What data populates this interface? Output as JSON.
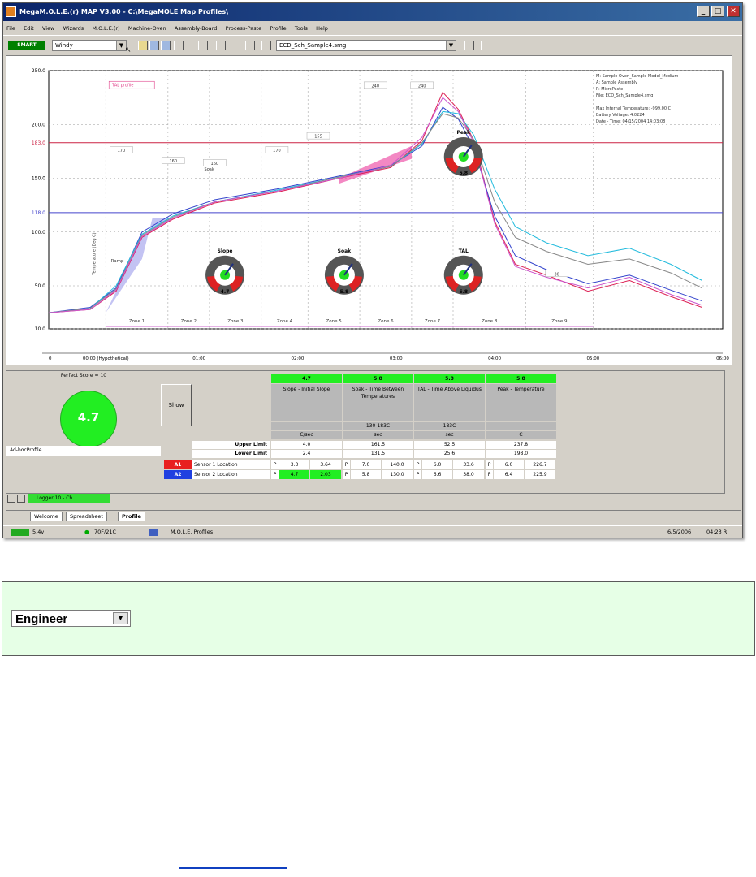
{
  "window": {
    "title": "MegaM.O.L.E.(r) MAP V3.00 - C:\\MegaMOLE Map Profiles\\",
    "controls": [
      "_",
      "□",
      "✕"
    ]
  },
  "menu": [
    "File",
    "Edit",
    "View",
    "Wizards",
    "M.O.L.E.(r)",
    "Machine-Oven",
    "Assembly-Board",
    "Process-Paste",
    "Profile",
    "Tools",
    "Help"
  ],
  "toolbar": {
    "logo": "SMART",
    "view_combo": "Windy",
    "profile_combo": "ECD_Sch_Sample4.smg",
    "pointer_glyph": "↖"
  },
  "chart_data": {
    "type": "line",
    "title": "",
    "ylabel": "",
    "xlabel": "",
    "ylim": [
      10,
      250
    ],
    "yticks": [
      "250.0",
      "200.0",
      "183.0",
      "150.0",
      "118.0",
      "100.0",
      "50.0",
      "10.0"
    ],
    "xticks": [
      "0",
      "00:00 (Hypothetical)",
      "01:00",
      "02:00",
      "03:00",
      "04:00",
      "05:00",
      "06:00"
    ],
    "xlim": [
      0,
      6.5
    ],
    "ref_lines": [
      {
        "label": "183.0",
        "y": 183,
        "color": "#cc2244"
      },
      {
        "label": "118.0",
        "y": 118,
        "color": "#4444cc"
      }
    ],
    "zones": [
      "Zone 1",
      "Zone 2",
      "Zone 3",
      "Zone 4",
      "Zone 5",
      "Zone 6",
      "Zone 7",
      "Zone 8",
      "Zone 9"
    ],
    "zone_boundaries": [
      0.55,
      1.15,
      1.55,
      2.05,
      2.5,
      3.0,
      3.5,
      3.9,
      4.6,
      5.25
    ],
    "annotations": {
      "liquidus_label": "TAL profile",
      "ramp": "Ramp",
      "soak_marker": "Soak",
      "boxes": [
        "170",
        "160",
        "160",
        "170",
        "240",
        "240",
        "155",
        "30"
      ],
      "side_label": "Temperature (Deg C)"
    },
    "info_text": [
      "M: Sample Oven_Sample Model_Medium",
      "A: Sample Assembly",
      "P: MicroPaste",
      "File: ECD_Sch_Sample4.smg",
      "",
      "Max Internal Temperature: -999.00 C",
      "Battery Voltage: 4.0224",
      "Date - Time: 04/15/2004 14:03:08"
    ],
    "gauges": [
      {
        "label": "Slope",
        "value": "4.7"
      },
      {
        "label": "Soak",
        "value": "5.8"
      },
      {
        "label": "TAL",
        "value": "5.8"
      },
      {
        "label": "Peak",
        "value": "5.8"
      }
    ],
    "series": [
      {
        "color": "#dd2255",
        "x": [
          0,
          0.4,
          0.65,
          0.9,
          1.2,
          1.6,
          2.2,
          2.8,
          3.3,
          3.6,
          3.8,
          3.95,
          4.1,
          4.3,
          4.5,
          4.8,
          5.2,
          5.6,
          6.0,
          6.3
        ],
        "y": [
          25,
          28,
          45,
          95,
          112,
          127,
          137,
          150,
          160,
          185,
          230,
          214,
          185,
          110,
          70,
          60,
          45,
          55,
          40,
          30
        ]
      },
      {
        "color": "#3344cc",
        "x": [
          0,
          0.4,
          0.65,
          0.9,
          1.2,
          1.6,
          2.2,
          2.8,
          3.3,
          3.6,
          3.8,
          3.95,
          4.1,
          4.3,
          4.5,
          4.8,
          5.2,
          5.6,
          6.0,
          6.3
        ],
        "y": [
          25,
          30,
          48,
          100,
          117,
          130,
          140,
          152,
          162,
          180,
          216,
          205,
          178,
          115,
          78,
          65,
          52,
          60,
          46,
          36
        ]
      },
      {
        "color": "#22bbdd",
        "x": [
          0,
          0.4,
          0.65,
          0.9,
          1.2,
          1.6,
          2.2,
          2.8,
          3.3,
          3.6,
          3.8,
          3.95,
          4.1,
          4.3,
          4.5,
          4.8,
          5.2,
          5.6,
          6.0,
          6.3
        ],
        "y": [
          25,
          29,
          50,
          98,
          115,
          128,
          139,
          151,
          161,
          182,
          212,
          210,
          190,
          140,
          105,
          90,
          78,
          85,
          70,
          55
        ]
      },
      {
        "color": "#888888",
        "x": [
          0,
          0.4,
          0.65,
          0.9,
          1.2,
          1.6,
          2.2,
          2.8,
          3.3,
          3.6,
          3.8,
          3.95,
          4.1,
          4.3,
          4.5,
          4.8,
          5.2,
          5.6,
          6.0,
          6.3
        ],
        "y": [
          25,
          29,
          47,
          97,
          114,
          128,
          138,
          151,
          161,
          183,
          210,
          206,
          186,
          128,
          95,
          82,
          70,
          75,
          62,
          48
        ]
      },
      {
        "color": "#cc55cc",
        "x": [
          0,
          0.4,
          0.65,
          0.9,
          1.2,
          1.6,
          2.2,
          2.8,
          3.3,
          3.6,
          3.8,
          3.95,
          4.1,
          4.3,
          4.5,
          4.8,
          5.2,
          5.6,
          6.0,
          6.3
        ],
        "y": [
          25,
          28,
          46,
          96,
          113,
          128,
          138,
          150,
          162,
          188,
          225,
          212,
          183,
          108,
          68,
          58,
          48,
          58,
          42,
          32
        ]
      }
    ]
  },
  "score": {
    "header": "Perfect Score = 10",
    "value": "4.7",
    "show_button": "Show",
    "profile_name": "Ad-hocProfile"
  },
  "grid": {
    "gauge_values": [
      "4.7",
      "5.8",
      "5.8",
      "5.8"
    ],
    "headers": [
      "Slope - Initial Slope",
      "Soak - Time Between Temperatures",
      "TAL - Time Above Liquidus",
      "Peak - Temperature"
    ],
    "subheaders": [
      "",
      "130-183C",
      "183C",
      ""
    ],
    "units": [
      "C/sec",
      "sec",
      "sec",
      "C"
    ],
    "rows": [
      {
        "label": "Upper Limit",
        "values": [
          "4.0",
          "161.5",
          "52.5",
          "237.8"
        ]
      },
      {
        "label": "Lower Limit",
        "values": [
          "2.4",
          "131.5",
          "25.6",
          "198.0"
        ]
      }
    ],
    "sensors": [
      {
        "tag": "A1",
        "color": "#e82020",
        "label": "Sensor 1 Location",
        "cells": [
          "P",
          "3.3",
          "3.64",
          "P",
          "7.0",
          "140.0",
          "P",
          "6.0",
          "33.6",
          "P",
          "6.0",
          "226.7"
        ]
      },
      {
        "tag": "A2",
        "color": "#2040e0",
        "label": "Sensor 2 Location",
        "cells": [
          "P",
          "4.7",
          "2.03",
          "P",
          "5.8",
          "130.0",
          "P",
          "6.6",
          "38.0",
          "P",
          "6.4",
          "225.9"
        ]
      }
    ],
    "sheet_tab": "Logger 10 - Ch"
  },
  "tabs": [
    "Welcome",
    "Spreadsheet",
    "Profile"
  ],
  "status": {
    "battery": "5.4v",
    "temp": "70F/21C",
    "mode": "M.O.L.E. Profiles",
    "date": "6/5/2006",
    "time": "04:23 R"
  },
  "role_select": {
    "value": "Engineer",
    "arrow": "▼"
  }
}
